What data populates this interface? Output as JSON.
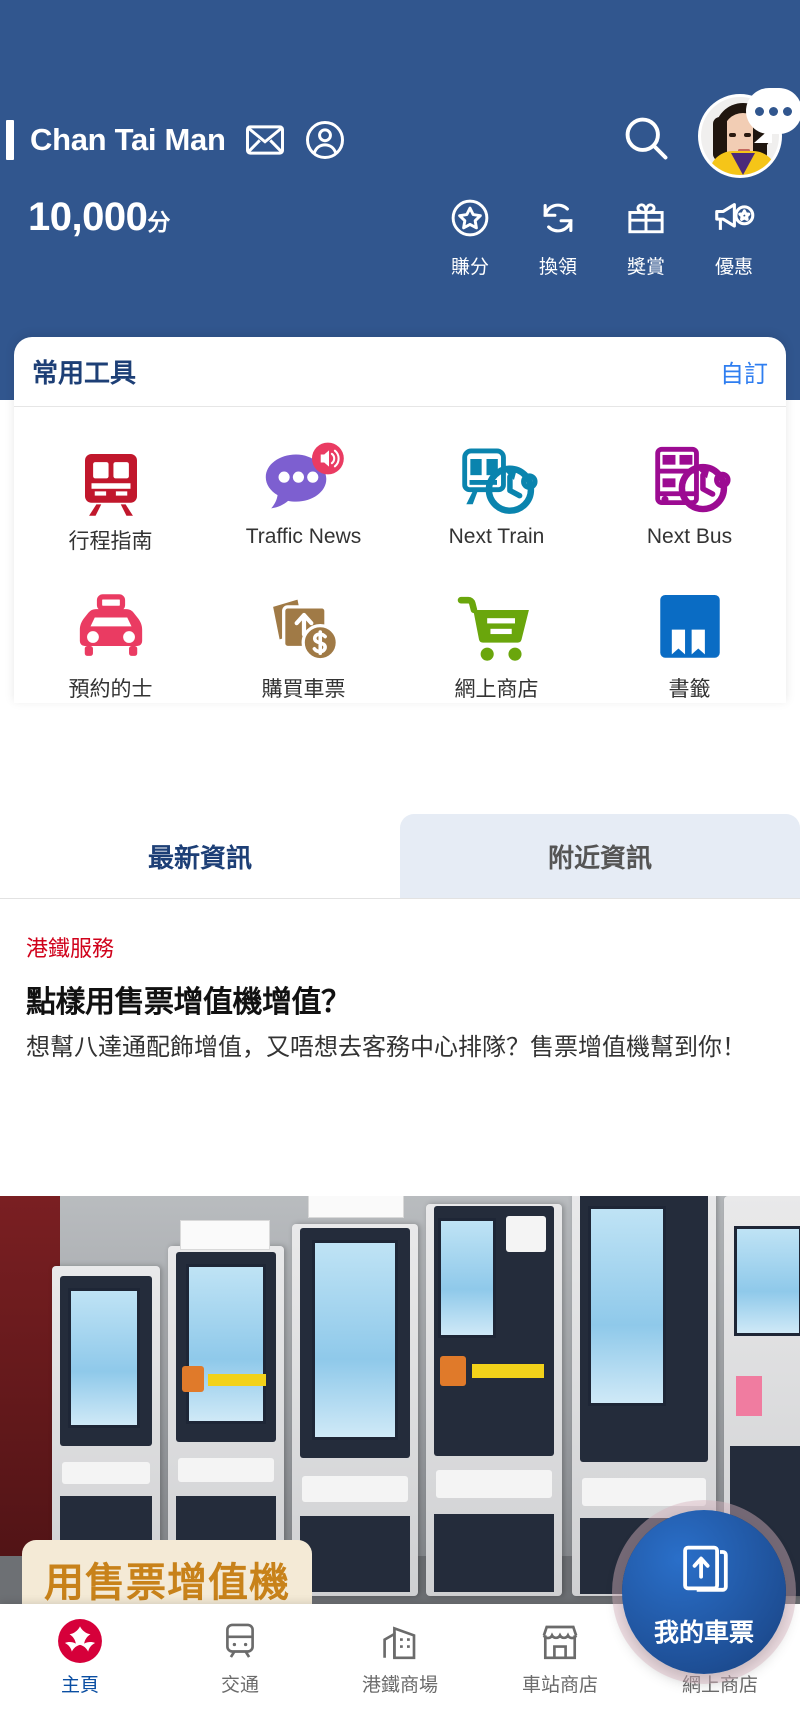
{
  "app": {
    "brand_blue": "#31568e",
    "accent_red": "#d0021b"
  },
  "header": {
    "user_name": "Chan Tai Man",
    "mail_icon": "mail-icon",
    "account_icon": "account-icon",
    "search_icon": "search-icon",
    "avatar_icon": "avatar",
    "chat_icon": "chat-bubble-icon",
    "points_value": "10,000",
    "points_unit": "分",
    "quick_actions": [
      {
        "label": "賺分",
        "icon": "star-circle-icon"
      },
      {
        "label": "換領",
        "icon": "refresh-icon"
      },
      {
        "label": "獎賞",
        "icon": "gift-icon"
      },
      {
        "label": "優惠",
        "icon": "megaphone-star-icon"
      }
    ]
  },
  "tools": {
    "title": "常用工具",
    "customize_label": "自訂",
    "items": [
      {
        "label": "行程指南",
        "icon": "train-front-icon",
        "color": "#c1172c"
      },
      {
        "label": "Traffic News",
        "icon": "chat-speaker-icon",
        "color": "#7d5fd0"
      },
      {
        "label": "Next Train",
        "icon": "train-clock-icon",
        "color": "#0a84ae"
      },
      {
        "label": "Next Bus",
        "icon": "bus-clock-icon",
        "color": "#9c0b92"
      },
      {
        "label": "預約的士",
        "icon": "taxi-icon",
        "color": "#ea3b62"
      },
      {
        "label": "購買車票",
        "icon": "ticket-money-icon",
        "color": "#a07a46"
      },
      {
        "label": "網上商店",
        "icon": "shopping-cart-icon",
        "color": "#6aa60c"
      },
      {
        "label": "書籤",
        "icon": "bookmark-icon",
        "color": "#0a6cc4"
      }
    ]
  },
  "tabs": [
    {
      "label": "最新資訊",
      "active": true
    },
    {
      "label": "附近資訊",
      "active": false
    }
  ],
  "news": {
    "category": "港鐵服務",
    "title": "點樣用售票增值機增值？",
    "body": "想幫八達通配飾增值，又唔想去客務中心排隊？售票增值機幫到你！",
    "photo_caption": "用售票增值機"
  },
  "bottom_nav": [
    {
      "label": "主頁",
      "icon": "mtr-logo-icon",
      "active": true
    },
    {
      "label": "交通",
      "icon": "train-icon",
      "active": false
    },
    {
      "label": "港鐵商場",
      "icon": "mall-icon",
      "active": false
    },
    {
      "label": "車站商店",
      "icon": "shop-icon",
      "active": false
    },
    {
      "label": "網上商店",
      "icon": "cart-icon",
      "active": false
    }
  ],
  "fab": {
    "label": "我的車票",
    "icon": "tickets-icon"
  }
}
